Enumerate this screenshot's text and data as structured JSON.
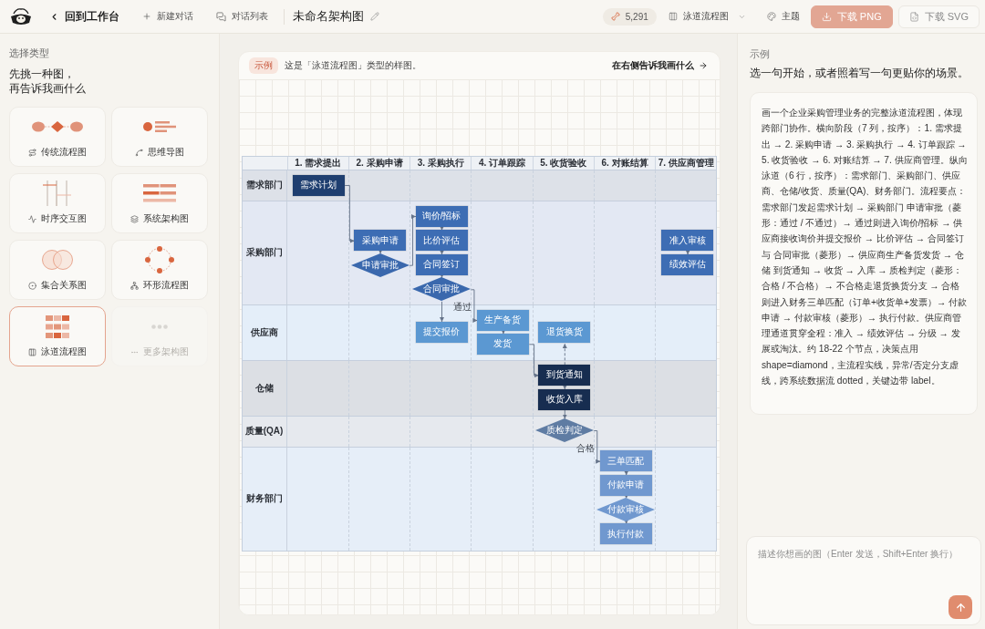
{
  "top_bar": {
    "back": "回到工作台",
    "new_chat": "新建对话",
    "chat_list": "对话列表",
    "doc_title": "未命名架构图",
    "credits": "5,291",
    "diagram_type": "泳道流程图",
    "theme": "主题",
    "download_png": "下载 PNG",
    "download_svg": "下载 SVG"
  },
  "sidebar": {
    "heading": "选择类型",
    "prompt": [
      "先挑一种图，",
      "再告诉我画什么"
    ],
    "types": [
      {
        "label": "传统流程图",
        "selected": false,
        "disabled": false
      },
      {
        "label": "思维导图",
        "selected": false,
        "disabled": false
      },
      {
        "label": "时序交互图",
        "selected": false,
        "disabled": false
      },
      {
        "label": "系统架构图",
        "selected": false,
        "disabled": false
      },
      {
        "label": "集合关系图",
        "selected": false,
        "disabled": false
      },
      {
        "label": "环形流程图",
        "selected": false,
        "disabled": false
      },
      {
        "label": "泳道流程图",
        "selected": true,
        "disabled": false
      },
      {
        "label": "更多架构图",
        "selected": false,
        "disabled": true
      }
    ]
  },
  "canvas": {
    "badge": "示例",
    "caption": "这是「泳道流程图」类型的样图。",
    "link": "在右侧告诉我画什么",
    "diagram": {
      "columns": [
        "1. 需求提出",
        "2. 采购申请",
        "3. 采购执行",
        "4. 订单跟踪",
        "5. 收货验收",
        "6. 对账结算",
        "7. 供应商管理"
      ],
      "lanes": [
        {
          "label": "需求部门",
          "color": "#dde1e8"
        },
        {
          "label": "采购部门",
          "color": "#e3e8f3"
        },
        {
          "label": "供应商",
          "color": "#e4eef9"
        },
        {
          "label": "仓储",
          "color": "#dcdfe4"
        },
        {
          "label": "质量(QA)",
          "color": "#e6e9ee"
        },
        {
          "label": "财务部门",
          "color": "#e6eef8"
        }
      ],
      "nodes": [
        {
          "label": "需求计划",
          "kind": "process",
          "color": "#1f3f70"
        },
        {
          "label": "采购申请",
          "kind": "process",
          "color": "#3d6db4"
        },
        {
          "label": "申请审批",
          "kind": "decision",
          "color": "#3a68ad"
        },
        {
          "label": "询价/招标",
          "kind": "process",
          "color": "#3d6db4"
        },
        {
          "label": "比价评估",
          "kind": "process",
          "color": "#3d6db4"
        },
        {
          "label": "合同签订",
          "kind": "process",
          "color": "#3d6db4"
        },
        {
          "label": "合同审批",
          "kind": "decision",
          "color": "#3a68ad"
        },
        {
          "label": "提交报价",
          "kind": "process",
          "color": "#5b98d2"
        },
        {
          "label": "生产备货",
          "kind": "process",
          "color": "#5b98d2"
        },
        {
          "label": "发货",
          "kind": "process",
          "color": "#5b98d2"
        },
        {
          "label": "退货换货",
          "kind": "process",
          "color": "#5b98d2"
        },
        {
          "label": "到货通知",
          "kind": "process",
          "color": "#172d50"
        },
        {
          "label": "收货入库",
          "kind": "process",
          "color": "#172d50"
        },
        {
          "label": "质检判定",
          "kind": "decision",
          "color": "#5f7ca3"
        },
        {
          "label": "三单匹配",
          "kind": "process",
          "color": "#7098cf"
        },
        {
          "label": "付款申请",
          "kind": "process",
          "color": "#7098cf"
        },
        {
          "label": "付款审核",
          "kind": "decision",
          "color": "#7098cf"
        },
        {
          "label": "执行付款",
          "kind": "process",
          "color": "#7098cf"
        },
        {
          "label": "准入审核",
          "kind": "process",
          "color": "#3d6db4"
        },
        {
          "label": "绩效评估",
          "kind": "process",
          "color": "#3d6db4"
        }
      ],
      "edge_labels": [
        "通过",
        "合格"
      ]
    }
  },
  "examples_panel": {
    "heading": "示例",
    "subheading": "选一句开始，或者照着写一句更贴你的场景。",
    "examples": [
      "画一个企业采购管理业务的完整泳道流程图，体现跨部门协作。横向阶段（7 列，按序）：1. 需求提出 → 2. 采购申请 → 3. 采购执行 → 4. 订单跟踪 → 5. 收货验收 → 6. 对账结算 → 7. 供应商管理。纵向泳道（6 行，按序）：需求部门、采购部门、供应商、仓储/收货、质量(QA)、财务部门。流程要点：需求部门发起需求计划 → 采购部门 申请审批（菱形：通过 / 不通过）→ 通过则进入询价/招标 → 供应商接收询价并提交报价 → 比价评估 → 合同签订与 合同审批（菱形）→ 供应商生产备货发货 → 仓储 到货通知 → 收货 → 入库 → 质检判定（菱形：合格 / 不合格）→ 不合格走退货换货分支 → 合格则进入财务三单匹配（订单+收货单+发票）→ 付款申请 → 付款审核（菱形）→ 执行付款。供应商管理通道贯穿全程：准入 → 绩效评估 → 分级 → 发展或淘汰。约 18-22 个节点，决策点用 shape=diamond，主流程实线，异常/否定分支虚线，跨系统数据流 dotted，关键边带 label。"
    ],
    "composer": {
      "placeholder": "描述你想画的图（Enter 发送，Shift+Enter 换行）"
    }
  }
}
